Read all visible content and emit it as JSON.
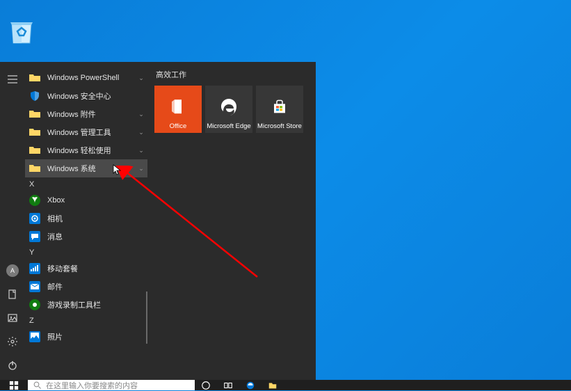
{
  "desktop": {
    "recycle_bin_label": "回收站"
  },
  "start_menu": {
    "tiles_header": "高效工作",
    "tiles": [
      {
        "label": "Office",
        "color": "#e64a19"
      },
      {
        "label": "Microsoft Edge",
        "color": "#373737"
      },
      {
        "label": "Microsoft Store",
        "color": "#373737"
      }
    ],
    "apps_top": [
      {
        "label": "Windows PowerShell",
        "icon": "folder-icon",
        "expandable": true
      },
      {
        "label": "Windows 安全中心",
        "icon": "shield-icon",
        "expandable": false
      },
      {
        "label": "Windows 附件",
        "icon": "folder-icon",
        "expandable": true
      },
      {
        "label": "Windows 管理工具",
        "icon": "folder-icon",
        "expandable": true
      },
      {
        "label": "Windows 轻松使用",
        "icon": "folder-icon",
        "expandable": true
      },
      {
        "label": "Windows 系统",
        "icon": "folder-icon",
        "expandable": true,
        "highlighted": true
      }
    ],
    "section_x": "X",
    "apps_x": [
      {
        "label": "Xbox",
        "icon": "xbox-icon"
      },
      {
        "label": "相机",
        "icon": "camera-icon"
      },
      {
        "label": "消息",
        "icon": "message-icon"
      }
    ],
    "section_y": "Y",
    "apps_y": [
      {
        "label": "移动套餐",
        "icon": "cellular-icon"
      },
      {
        "label": "邮件",
        "icon": "mail-icon"
      },
      {
        "label": "游戏录制工具栏",
        "icon": "gamebar-icon"
      }
    ],
    "section_z": "Z",
    "apps_z": [
      {
        "label": "照片",
        "icon": "photos-icon"
      }
    ],
    "rail": {
      "user_initial": "A"
    }
  },
  "taskbar": {
    "search_placeholder": "在这里输入你要搜索的内容"
  },
  "colors": {
    "accent": "#0078d7",
    "menu_bg": "#2b2b2b",
    "desktop_bg": "#0a7dd8"
  }
}
